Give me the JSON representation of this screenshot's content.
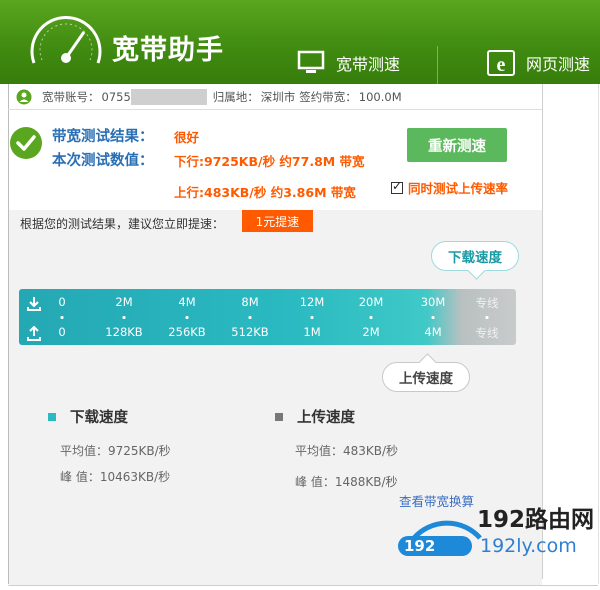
{
  "header": {
    "app_title": "宽带助手",
    "nav": {
      "broadband_speed": "宽带测速",
      "web_speed": "网页测速"
    },
    "colors": {
      "header_green": "#3f8a10",
      "accent_orange": "#ff5a00",
      "label_blue": "#2a6fb4",
      "teal": "#2bbac1"
    }
  },
  "account": {
    "account_label": "宽带账号：",
    "account_value": "0755",
    "location_label": "归属地：",
    "location_value": "深圳市",
    "contract_label": "签约带宽：",
    "contract_value": "100.0M"
  },
  "result": {
    "test_result_label": "带宽测试结果：",
    "test_result_value": "很好",
    "test_value_label": "本次测试数值：",
    "download_line": "下行:9725KB/秒 约77.8M 带宽",
    "upload_line": "上行:483KB/秒 约3.86M 带宽",
    "retest_button": "重新测速",
    "upload_checkbox_label": "同时测试上传速率",
    "upload_checkbox_checked": true
  },
  "suggestion": {
    "text": "根据您的测试结果，建议您立即提速：",
    "button": "1元提速"
  },
  "gauge": {
    "download_bubble": "下载速度",
    "upload_bubble": "上传速度",
    "download_ticks": [
      "0",
      "2M",
      "4M",
      "8M",
      "12M",
      "20M",
      "30M",
      "专线"
    ],
    "upload_ticks": [
      "0",
      "128KB",
      "256KB",
      "512KB",
      "1M",
      "2M",
      "4M",
      "专线"
    ]
  },
  "stats": {
    "download": {
      "title": "下载速度",
      "avg": "平均值：9725KB/秒",
      "peak": "峰  值：10463KB/秒"
    },
    "upload": {
      "title": "上传速度",
      "avg": "平均值：483KB/秒",
      "peak": "峰  值：1488KB/秒"
    }
  },
  "watermark": {
    "link_text": "查看带宽换算",
    "brand_cn": "192路由网",
    "pill": "192",
    "domain": "192ly.com"
  }
}
